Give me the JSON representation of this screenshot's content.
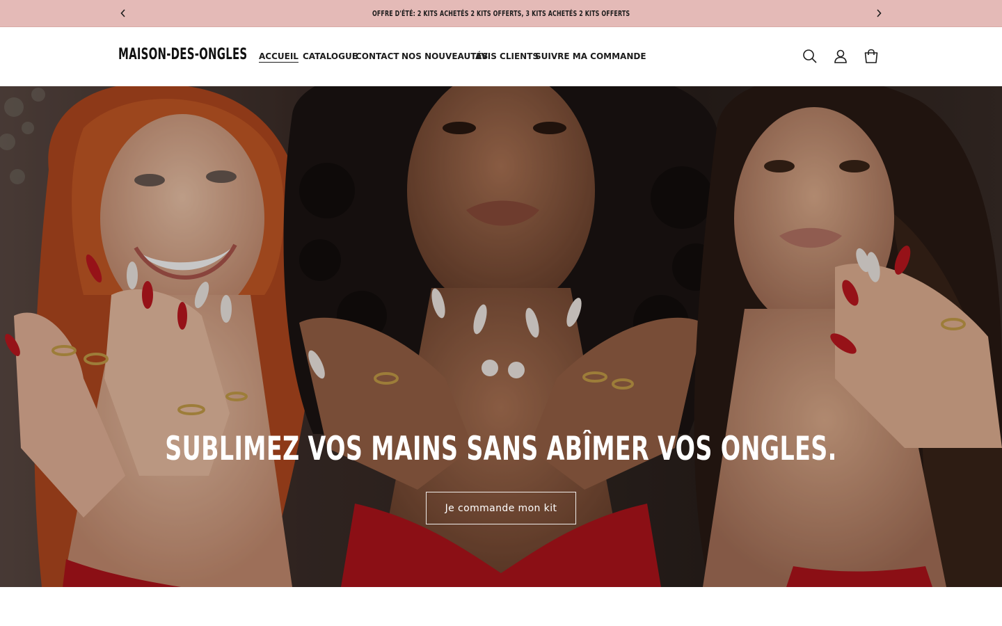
{
  "announcement": {
    "text": "OFFRE D'ÉTÉ: 2 KITS ACHETÉS 2 KITS OFFERTS, 3 KITS ACHETÉS 2 KITS OFFERTS",
    "prev_icon": "chevron-left-icon",
    "next_icon": "chevron-right-icon",
    "background": "#e4bab7"
  },
  "header": {
    "logo": "MAISON-DES-ONGLES",
    "nav": [
      {
        "label": "ACCUEIL",
        "active": true
      },
      {
        "label": "CATALOGUE",
        "active": false
      },
      {
        "label": "CONTACT",
        "active": false
      },
      {
        "label": "NOS NOUVEAUTÉS",
        "active": false
      },
      {
        "label": "AVIS CLIENTS",
        "active": false
      },
      {
        "label": "SUIVRE MA COMMANDE",
        "active": false
      }
    ],
    "icons": [
      "search-icon",
      "account-icon",
      "cart-icon"
    ]
  },
  "hero": {
    "title": "SUBLIMEZ VOS MAINS SANS ABÎMER VOS ONGLES.",
    "button_label": "Je commande mon kit",
    "image_subject": "three women with manicured nails posing with hands near faces",
    "accent_colors": {
      "dress_red": "#b3141c",
      "nail_red": "#c0181f",
      "nail_white": "#f4eee8"
    }
  }
}
